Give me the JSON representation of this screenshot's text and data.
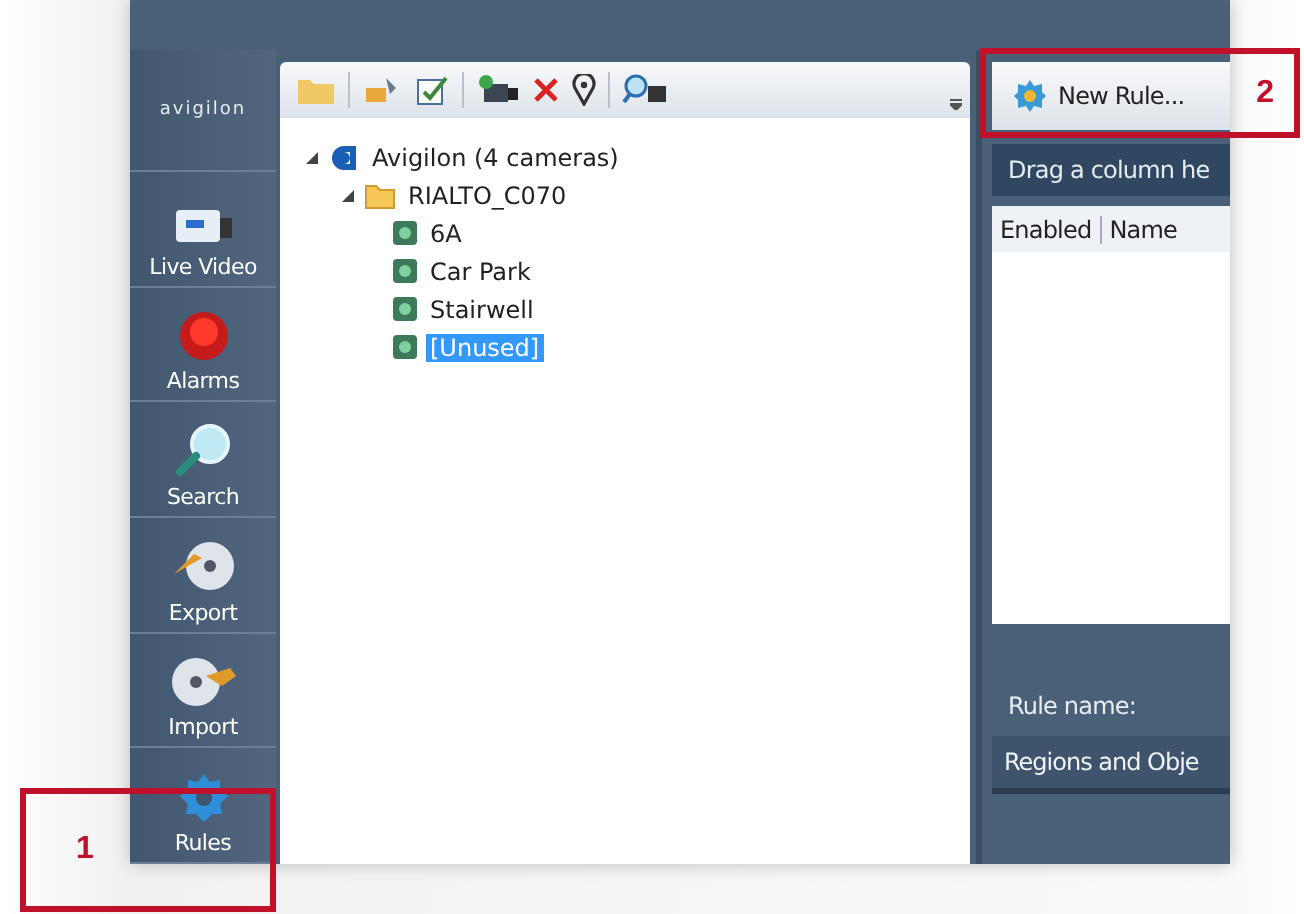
{
  "sidebar": {
    "logo": "avigilon",
    "items": [
      {
        "label": "Live Video",
        "kind": "live_video"
      },
      {
        "label": "Alarms",
        "kind": "alarms"
      },
      {
        "label": "Search",
        "kind": "search"
      },
      {
        "label": "Export",
        "kind": "export"
      },
      {
        "label": "Import",
        "kind": "import"
      },
      {
        "label": "Rules",
        "kind": "rules"
      }
    ]
  },
  "tree": [
    {
      "label": "Avigilon  (4 cameras)",
      "kind": "site",
      "expanded": true,
      "children": [
        {
          "label": "RIALTO_C070",
          "kind": "folder",
          "expanded": true,
          "children": [
            {
              "label": "6A",
              "kind": "camera",
              "selected": false
            },
            {
              "label": "Car Park",
              "kind": "camera",
              "selected": false
            },
            {
              "label": "Stairwell",
              "kind": "camera",
              "selected": false
            },
            {
              "label": "[Unused]",
              "kind": "camera",
              "selected": true
            }
          ]
        }
      ]
    }
  ],
  "rules_panel": {
    "new_rule_button": "New Rule...",
    "group_hint": "Drag a column he",
    "columns": [
      "Enabled",
      "Name"
    ],
    "rule_name_label": "Rule name:",
    "rule_name_value": "Regions and Obje"
  },
  "callouts": [
    {
      "number": "1"
    },
    {
      "number": "2"
    }
  ]
}
